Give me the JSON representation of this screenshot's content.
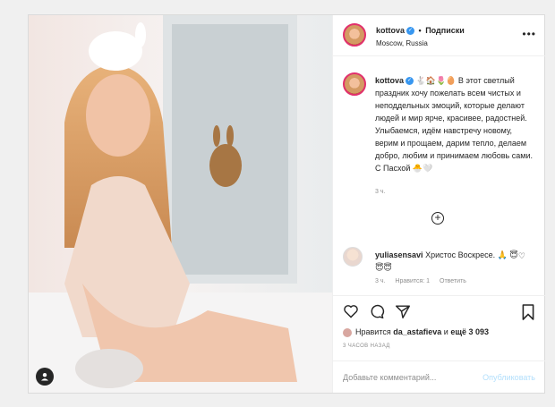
{
  "header": {
    "username": "kottova",
    "separator": "•",
    "follow_label": "Подписки",
    "location": "Moscow, Russia",
    "more_glyph": "•••"
  },
  "caption": {
    "username": "kottova",
    "text": "🐇🏠🌷🥚 В этот светлый праздник хочу пожелать всем чистых и неподдельных эмоций, которые делают людей и мир ярче, красивее, радостней. Улыбаемся, идём навстречу новому, верим и прощаем, дарим тепло, делаем добро, любим и принимаем любовь сами. С Пасхой 🐣🤍",
    "time": "3 ч."
  },
  "comment": {
    "username": "yuliasensavi",
    "text": "Христос Воскресе. 🙏 😇😇😇",
    "time": "3 ч.",
    "likes": "Нравится: 1",
    "reply": "Ответить"
  },
  "likes": {
    "prefix": "Нравится",
    "user": "da_astafieva",
    "middle": "и",
    "count": "ещё 3 093"
  },
  "timestamp": "3 ЧАСОВ НАЗАД",
  "comment_input": {
    "placeholder": "Добавьте комментарий...",
    "publish": "Опубликовать"
  },
  "colors": {
    "verified": "#3897f0",
    "publish_disabled": "#b2dffc",
    "story_ring": "#e1306c"
  }
}
